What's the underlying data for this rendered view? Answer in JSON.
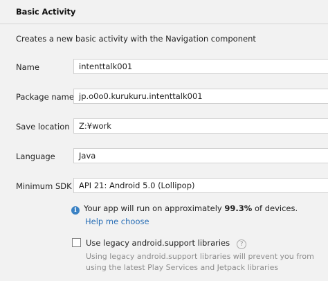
{
  "header": {
    "title": "Basic Activity"
  },
  "description": "Creates a new basic activity with the Navigation component",
  "form": {
    "name": {
      "label": "Name",
      "value": "intenttalk001"
    },
    "package_name": {
      "label": "Package name",
      "value": "jp.o0o0.kurukuru.intenttalk001"
    },
    "save_location": {
      "label": "Save location",
      "value": "Z:¥work"
    },
    "language": {
      "label": "Language",
      "value": "Java"
    },
    "minimum_sdk": {
      "label": "Minimum SDK",
      "value": "API 21: Android 5.0 (Lollipop)"
    }
  },
  "info": {
    "icon": "info-icon",
    "text_before": "Your app will run on approximately ",
    "percent": "99.3%",
    "text_after": " of devices.",
    "help_link": "Help me choose"
  },
  "legacy": {
    "checked": false,
    "label": "Use legacy android.support libraries",
    "help_icon": "help-question-icon",
    "help_glyph": "?",
    "note": "Using legacy android.support libraries will prevent you from using the latest Play Services and Jetpack libraries"
  },
  "colors": {
    "background": "#f2f2f2",
    "link": "#2a6fb6",
    "info_icon": "#3b82c4",
    "muted_text": "#8c8c8c"
  }
}
